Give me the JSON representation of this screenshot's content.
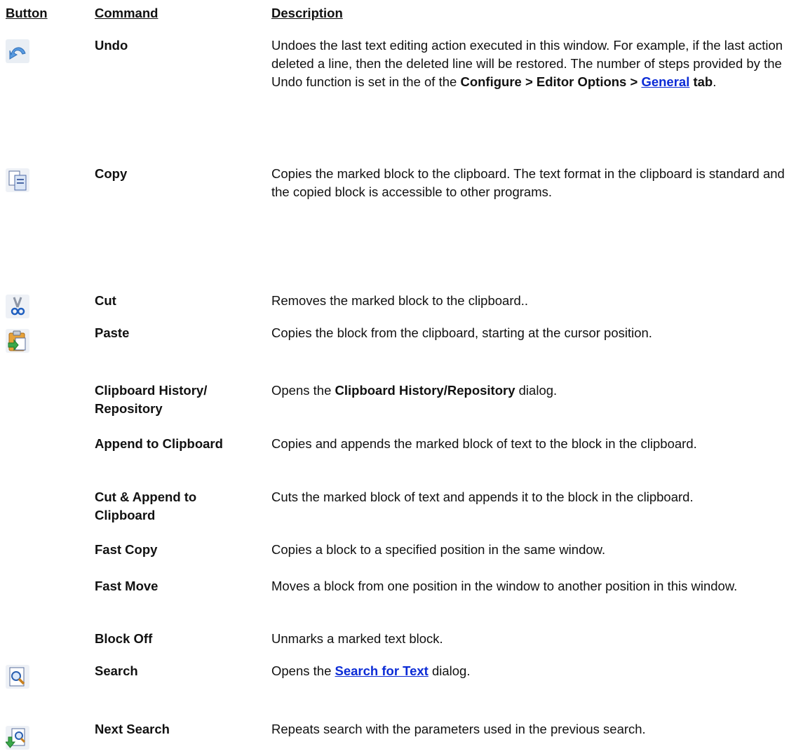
{
  "headers": {
    "button": "Button",
    "command": "Command",
    "description": "Description"
  },
  "rows": [
    {
      "icon": "undo-icon",
      "command": "Undo",
      "desc_pre": "Undoes the last text editing action executed in this window. For example, if the last action deleted a line, then the deleted line will be restored. The number of steps provided by the Undo function is set in the of the ",
      "desc_bold1": "Configure > Editor Options > ",
      "desc_link": "General",
      "desc_bold2": " tab",
      "desc_post": "."
    },
    {
      "icon": "copy-icon",
      "command": "Copy",
      "desc": "Copies the marked block to the clipboard. The text format in the clipboard is standard and the copied block is accessible to other programs."
    },
    {
      "icon": "cut-icon",
      "command": "Cut",
      "desc": "Removes the marked block to the clipboard.."
    },
    {
      "icon": "paste-icon",
      "command": "Paste",
      "desc": "Copies the block from the clipboard, starting at the cursor position."
    },
    {
      "command": "Clipboard History/ Repository",
      "desc_pre": "Opens the  ",
      "desc_bold": "Clipboard History/Repository",
      "desc_post": " dialog."
    },
    {
      "command": "Append to Clipboard",
      "desc": "Copies and appends the marked block of text to the block in the clipboard."
    },
    {
      "command": "Cut & Append to Clipboard",
      "desc": "Cuts the marked block of text and appends it to the block in the clipboard."
    },
    {
      "command": "Fast Copy",
      "desc": "Copies a block to a specified position in the same window."
    },
    {
      "command": "Fast Move",
      "desc": "Moves a block from one position in the window to another position in this window."
    },
    {
      "command": "Block Off",
      "desc": "Unmarks a marked text block."
    },
    {
      "icon": "search-icon",
      "command": "Search",
      "desc_pre": "Opens the ",
      "desc_link": "Search for Text",
      "desc_post": "  dialog."
    },
    {
      "icon": "next-search-icon",
      "command": "Next Search",
      "desc": "Repeats search with the parameters used in the previous search."
    }
  ]
}
